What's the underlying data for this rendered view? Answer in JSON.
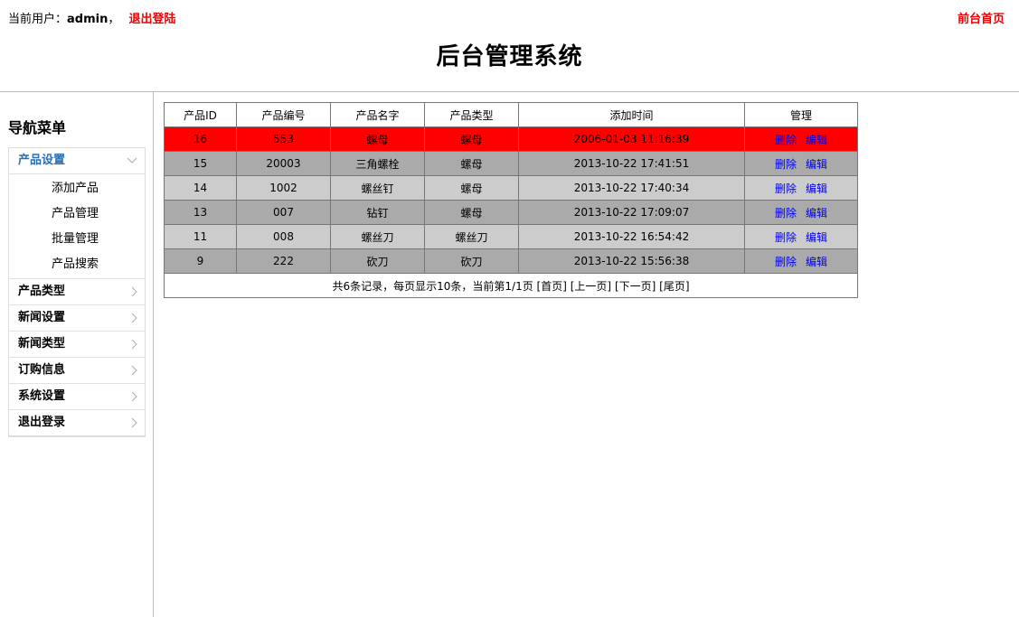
{
  "header": {
    "user_prefix": "当前用户：",
    "username": "admin",
    "separator": "，",
    "logout_label": "退出登陆",
    "front_home_label": "前台首页",
    "title": "后台管理系统"
  },
  "sidebar": {
    "title": "导航菜单",
    "groups": [
      {
        "label": "产品设置",
        "expanded": true,
        "items": [
          "添加产品",
          "产品管理",
          "批量管理",
          "产品搜索"
        ]
      },
      {
        "label": "产品类型",
        "expanded": false
      },
      {
        "label": "新闻设置",
        "expanded": false
      },
      {
        "label": "新闻类型",
        "expanded": false
      },
      {
        "label": "订购信息",
        "expanded": false
      },
      {
        "label": "系统设置",
        "expanded": false
      },
      {
        "label": "退出登录",
        "expanded": false
      }
    ]
  },
  "table": {
    "columns": [
      "产品ID",
      "产品编号",
      "产品名字",
      "产品类型",
      "添加时间",
      "管理"
    ],
    "rows": [
      {
        "id": "16",
        "code": "553",
        "name": "螺母",
        "type": "螺母",
        "time": "2006-01-03 11:16:39",
        "style": "red"
      },
      {
        "id": "15",
        "code": "20003",
        "name": "三角螺栓",
        "type": "螺母",
        "time": "2013-10-22 17:41:51",
        "style": "dark"
      },
      {
        "id": "14",
        "code": "1002",
        "name": "螺丝钉",
        "type": "螺母",
        "time": "2013-10-22 17:40:34",
        "style": "light"
      },
      {
        "id": "13",
        "code": "007",
        "name": "钻钉",
        "type": "螺母",
        "time": "2013-10-22 17:09:07",
        "style": "dark"
      },
      {
        "id": "11",
        "code": "008",
        "name": "螺丝刀",
        "type": "螺丝刀",
        "time": "2013-10-22 16:54:42",
        "style": "light"
      },
      {
        "id": "9",
        "code": "222",
        "name": "砍刀",
        "type": "砍刀",
        "time": "2013-10-22 15:56:38",
        "style": "dark"
      }
    ],
    "delete_label": "删除",
    "edit_label": "编辑",
    "pager": {
      "summary": "共6条记录，每页显示10条，当前第1/1页",
      "first": "[首页]",
      "prev": "[上一页]",
      "next": "[下一页]",
      "last": "[尾页]"
    }
  },
  "colors": {
    "highlight_row": "#ff0000",
    "dark_row": "#aaaaaa",
    "light_row": "#cccccc",
    "link_red": "#ee0000",
    "active_menu": "#2a6fb0",
    "action_link": "#0000ee"
  },
  "icons": {
    "expanded_chevron": "chevron-down-icon",
    "collapsed_chevron": "chevron-right-icon"
  }
}
